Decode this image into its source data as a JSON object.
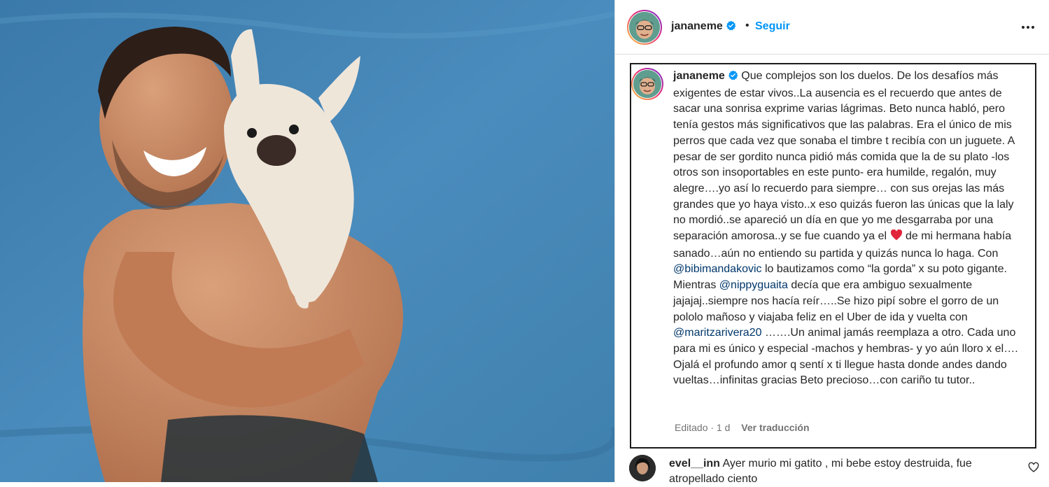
{
  "post": {
    "username": "jananeme",
    "follow_label": "Seguir",
    "separator": "•"
  },
  "caption": {
    "username": "jananeme",
    "part1": " Que complejos son los duelos. De los desafíos más exigentes de estar vivos..La ausencia es el recuerdo que antes de sacar una sonrisa exprime varias lágrimas. Beto nunca habló, pero tenía gestos más significativos que las palabras. Era el único de mis perros que cada vez que sonaba el timbre t recibía con un juguete. A pesar de ser gordito nunca pidió más comida que la de su plato -los otros son insoportables en este punto- era humilde, regalón, muy alegre….yo así lo recuerdo para siempre… con sus orejas las más grandes que yo haya visto..x eso quizás fueron las únicas que la laly no mordió..se apareció un día en que yo me desgarraba por una separación amorosa..y se fue cuando ya el ",
    "part2": " de mi hermana había sanado…aún no entiendo su partida y quizás nunca lo haga. Con ",
    "mention1": "@bibimandakovic",
    "part3": " lo bautizamos como “la gorda” x su poto gigante. Mientras ",
    "mention2": "@nippyguaita",
    "part4": " decía que era ambiguo sexualmente jajajaj..siempre nos hacía reír…..Se hizo pipí sobre el gorro de un pololo mañoso y viajaba feliz en el Uber de ida y vuelta con ",
    "mention3": "@maritzarivera20",
    "part5": " …….Un animal jamás reemplaza a otro. Cada uno para mi es único y especial -machos y hembras- y yo aún lloro x el…. Ojalá el profundo amor q sentí x ti llegue hasta donde andes dando vueltas…infinitas gracias Beto precioso…con cariño tu tutor..",
    "edited_label": "Editado · 1 d",
    "translate_label": "Ver traducción"
  },
  "comment": {
    "username": "evel__inn",
    "text": " Ayer murio mi gatito , mi bebe estoy destruida, fue atropellado ciento"
  },
  "colors": {
    "accent": "#0095f6",
    "mention": "#00376b",
    "verified": "#0095f6",
    "heart": "#ed4956",
    "pool": "#3f7fb0"
  },
  "icons": {
    "verified": "verified-badge-icon",
    "more": "more-options-icon",
    "heart": "red-heart-emoji",
    "like": "like-heart-icon"
  }
}
